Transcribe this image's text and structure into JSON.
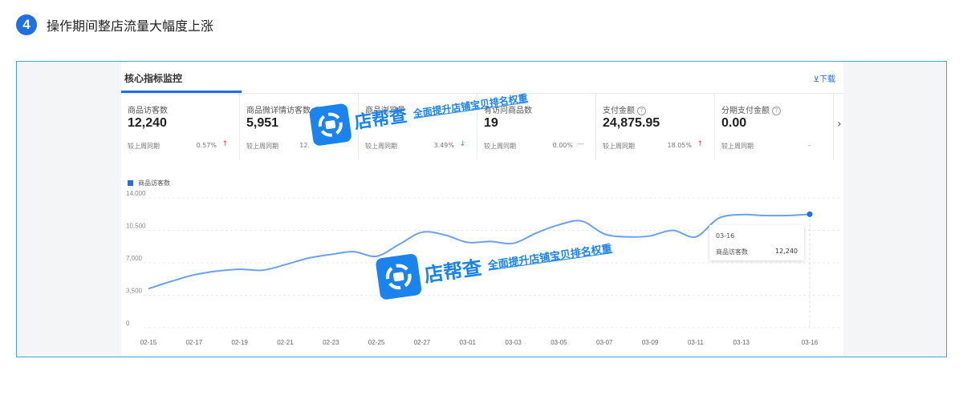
{
  "step": {
    "number": "4",
    "title": "操作期间整店流量大幅度上涨"
  },
  "panel": {
    "title": "核心指标监控",
    "download_label": "⊻下载"
  },
  "metrics": [
    {
      "label": "商品访客数",
      "value": "12,240",
      "compare": "较上周同期",
      "change": "0.57%",
      "trend": "↑",
      "trend_dir": "up"
    },
    {
      "label": "商品微详情访客数",
      "value": "5,951",
      "compare": "较上周同期",
      "change": "12.",
      "trend": "",
      "trend_dir": "none"
    },
    {
      "label": "商品浏览量",
      "value": "",
      "compare": "较上周同期",
      "change": "3.49%",
      "trend": "↓",
      "trend_dir": "down"
    },
    {
      "label": "有访问商品数",
      "value": "19",
      "compare": "较上周同期",
      "change": "0.00%",
      "trend": "—",
      "trend_dir": "flat"
    },
    {
      "label": "支付金额",
      "value": "24,875.95",
      "compare": "较上周同期",
      "change": "18.05%",
      "trend": "↑",
      "trend_dir": "up"
    },
    {
      "label": "分期支付金额",
      "value": "0.00",
      "compare": "较上周同期",
      "change": "-",
      "trend": "",
      "trend_dir": "none"
    }
  ],
  "more_arrow": "›",
  "legend_label": "商品访客数",
  "tooltip": {
    "date": "03-16",
    "name": "商品访客数",
    "value": "12,240"
  },
  "watermark": {
    "name": "店帮查",
    "slogan": "全面提升店铺宝贝排名权重"
  },
  "colors": {
    "accent": "#1f6fe5",
    "line": "#6e9ff0",
    "up": "#e64545",
    "down": "#29a35a",
    "frame_border": "#4aa3d8",
    "watermark": "#1a83ee"
  },
  "chart_data": {
    "type": "line",
    "y_ticks": [
      "14,000",
      "10,500",
      "7,000",
      "3,500",
      "0"
    ],
    "ylim": [
      0,
      14000
    ],
    "x_ticks": [
      "02-15",
      "02-17",
      "02-19",
      "02-21",
      "02-23",
      "02-25",
      "02-27",
      "03-01",
      "03-03",
      "03-05",
      "03-07",
      "03-09",
      "03-11",
      "03-13",
      "03-16"
    ],
    "series": [
      {
        "name": "商品访客数",
        "x": [
          "02-15",
          "02-16",
          "02-17",
          "02-18",
          "02-19",
          "02-20",
          "02-21",
          "02-22",
          "02-23",
          "02-24",
          "02-25",
          "02-26",
          "02-27",
          "02-28",
          "03-01",
          "03-02",
          "03-03",
          "03-04",
          "03-05",
          "03-06",
          "03-07",
          "03-08",
          "03-09",
          "03-10",
          "03-11",
          "03-12",
          "03-13",
          "03-14",
          "03-15",
          "03-16"
        ],
        "values": [
          4200,
          5000,
          5700,
          6100,
          6300,
          6200,
          6800,
          7500,
          7900,
          8200,
          7700,
          9000,
          10300,
          10000,
          9200,
          9300,
          9100,
          10200,
          11100,
          11500,
          10100,
          9800,
          9900,
          10500,
          9800,
          11800,
          12200,
          12100,
          12100,
          12240
        ]
      }
    ],
    "grid": true,
    "legend": "top-left"
  }
}
